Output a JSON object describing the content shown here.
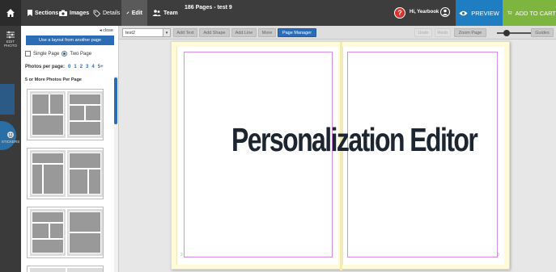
{
  "app": {
    "doc_title": "186 Pages - test 9",
    "greeting": "Hi, Yearbook",
    "preview_label": "PREVIEW",
    "cart_label": "ADD TO CART"
  },
  "nav": {
    "sections": "Sections",
    "images": "Images",
    "details": "Details",
    "edit": "Edit",
    "team": "Team"
  },
  "rail": {
    "edit_photo": "EDIT PHOTO",
    "stickers": "STICKERS"
  },
  "panel": {
    "close": "◂ close",
    "use_layout": "Use a layout from another page",
    "single_page": "Single Page",
    "two_page": "Two Page",
    "selected_mode": "Two Page",
    "photos_per_page_label": "Photos per page:",
    "photo_options": [
      "0",
      "1",
      "2",
      "3",
      "4",
      "5+"
    ],
    "group_label": "5 or More Photos Per Page"
  },
  "toolbar": {
    "page_select": "test2",
    "add_text": "Add Text",
    "add_shape": "Add Shape",
    "add_line": "Add Line",
    "more": "More",
    "page_manager": "Page Manager",
    "undo": "Undo",
    "redo": "Redo",
    "zoom_page": "Zoom Page",
    "guides": "Guides"
  },
  "canvas": {
    "left_page_number": "2",
    "right_page_number": "3"
  },
  "overlay": {
    "title": "Personalization Editor"
  },
  "colors": {
    "topbar": "#3d3d3d",
    "accent_blue": "#2b6cb6",
    "preview_blue": "#1f7dc1",
    "cart_green": "#7db53e",
    "bleed_line": "#d98be6",
    "spread_bg": "#fffbd8"
  }
}
